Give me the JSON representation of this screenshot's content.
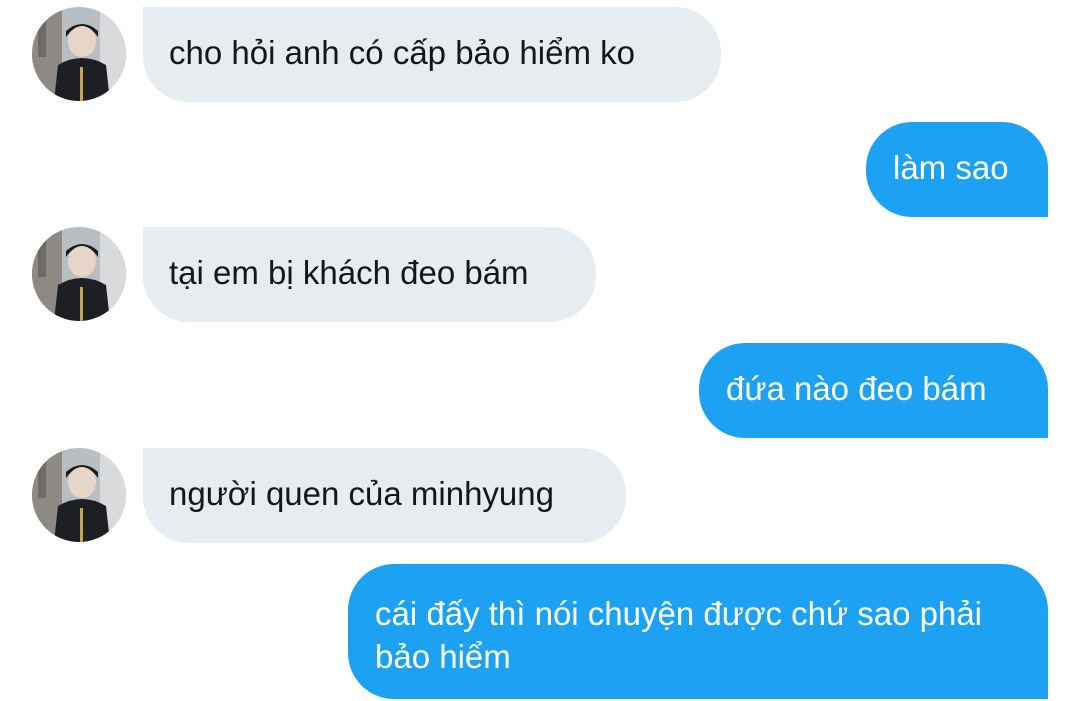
{
  "conversation": {
    "messages": [
      {
        "direction": "incoming",
        "text": "cho hỏi anh có cấp bảo hiểm ko"
      },
      {
        "direction": "outgoing",
        "text": "làm sao"
      },
      {
        "direction": "incoming",
        "text": "tại em bị khách đeo bám"
      },
      {
        "direction": "outgoing",
        "text": "đứa nào đeo bám"
      },
      {
        "direction": "incoming",
        "text": "người quen của minhyung"
      },
      {
        "direction": "outgoing",
        "text": "cái đấy thì nói chuyện được chứ sao phải bảo hiểm"
      }
    ]
  },
  "colors": {
    "incoming_bubble": "#e6ecf0",
    "outgoing_bubble": "#1da1f2",
    "incoming_text": "#14171a",
    "outgoing_text": "#ffffff"
  },
  "icons": {
    "avatar": "contact-avatar-photo"
  }
}
